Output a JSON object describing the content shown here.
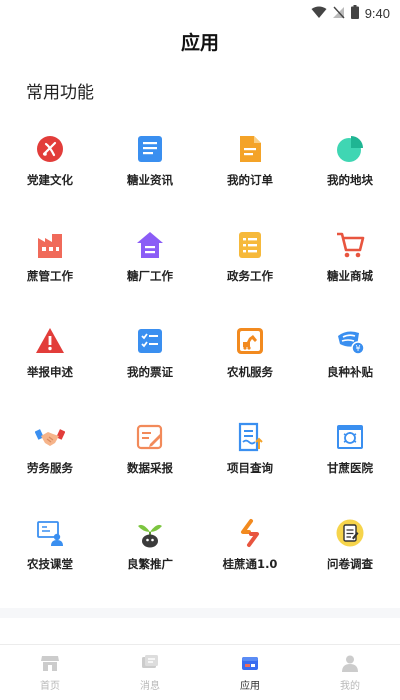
{
  "status_bar": {
    "time": "9:40"
  },
  "page": {
    "title": "应用"
  },
  "section": {
    "title": "常用功能"
  },
  "functions": [
    {
      "label": "党建文化",
      "icon": "party-emblem-icon"
    },
    {
      "label": "糖业资讯",
      "icon": "news-document-icon"
    },
    {
      "label": "我的订单",
      "icon": "order-file-icon"
    },
    {
      "label": "我的地块",
      "icon": "pie-chart-icon"
    },
    {
      "label": "蔗管工作",
      "icon": "factory-icon"
    },
    {
      "label": "糖厂工作",
      "icon": "house-icon"
    },
    {
      "label": "政务工作",
      "icon": "list-document-icon"
    },
    {
      "label": "糖业商城",
      "icon": "shopping-cart-icon"
    },
    {
      "label": "举报申述",
      "icon": "warning-icon"
    },
    {
      "label": "我的票证",
      "icon": "checklist-icon"
    },
    {
      "label": "农机服务",
      "icon": "excavator-icon"
    },
    {
      "label": "良种补贴",
      "icon": "seed-subsidy-icon"
    },
    {
      "label": "劳务服务",
      "icon": "handshake-icon"
    },
    {
      "label": "数据采报",
      "icon": "data-report-icon"
    },
    {
      "label": "项目查询",
      "icon": "project-query-icon"
    },
    {
      "label": "甘蔗医院",
      "icon": "sugarcane-hospital-icon"
    },
    {
      "label": "农技课堂",
      "icon": "training-classroom-icon"
    },
    {
      "label": "良繁推广",
      "icon": "sprout-icon"
    },
    {
      "label": "桂蔗通1.0",
      "icon": "app-logo-icon"
    },
    {
      "label": "问卷调查",
      "icon": "questionnaire-icon"
    }
  ],
  "tabbar": {
    "tabs": [
      {
        "label": "首页",
        "icon": "home-store-icon",
        "active": false
      },
      {
        "label": "消息",
        "icon": "message-icon",
        "active": false
      },
      {
        "label": "应用",
        "icon": "apps-icon",
        "active": true
      },
      {
        "label": "我的",
        "icon": "profile-icon",
        "active": false
      }
    ]
  },
  "colors": {
    "red": "#e23d3a",
    "blue": "#3a8ff0",
    "orange": "#f4a328",
    "teal": "#3fd6b3",
    "purple": "#8b5cf6",
    "tab_active": "#3a6df0",
    "tab_inactive": "#cccccc"
  }
}
